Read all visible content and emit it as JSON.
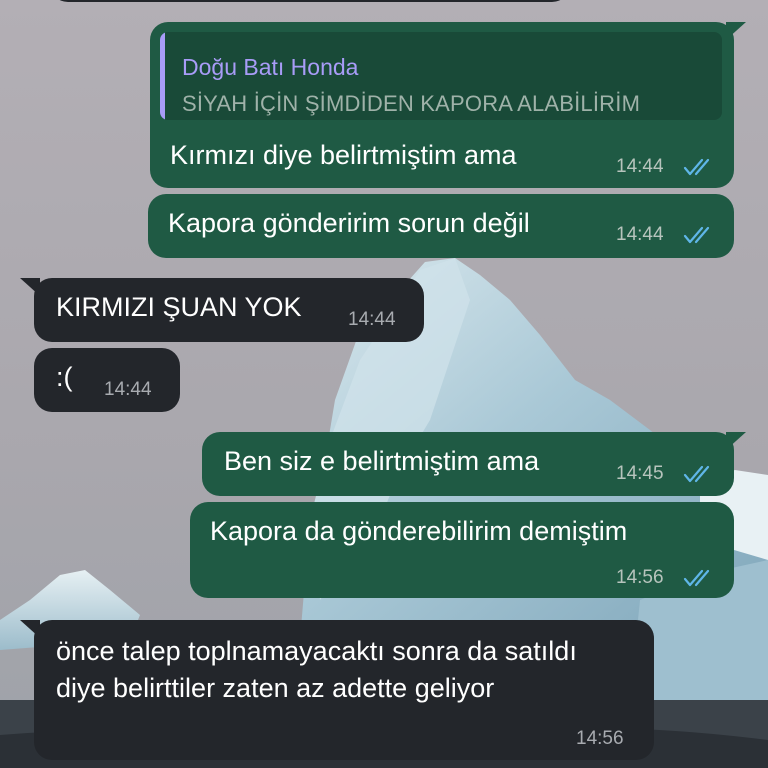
{
  "colors": {
    "outgoing_bubble": "#1f5a44",
    "incoming_bubble": "#23262b",
    "read_ticks": "#5fb6e8",
    "quote_accent": "#a89cf7"
  },
  "messages": [
    {
      "direction": "outgoing",
      "reply": {
        "author": "Doğu Batı Honda",
        "text": "SİYAH İÇİN ŞİMDİDEN KAPORA ALABİLİRİM"
      },
      "text": "Kırmızı diye belirtmiştim ama",
      "time": "14:44",
      "status_icon": "double-check-read-icon"
    },
    {
      "direction": "outgoing",
      "text": "Kapora gönderirim sorun değil",
      "time": "14:44",
      "status_icon": "double-check-read-icon"
    },
    {
      "direction": "incoming",
      "text": "KIRMIZI ŞUAN YOK",
      "time": "14:44"
    },
    {
      "direction": "incoming",
      "text": ":(",
      "time": "14:44"
    },
    {
      "direction": "outgoing",
      "text": "Ben siz e belirtmiştim ama",
      "time": "14:45",
      "status_icon": "double-check-read-icon"
    },
    {
      "direction": "outgoing",
      "text": "Kapora da gönderebilirim demiştim",
      "time": "14:56",
      "status_icon": "double-check-read-icon"
    },
    {
      "direction": "incoming",
      "text": "önce talep toplnamayacaktı sonra da satıldı diye belirttiler zaten az adette geliyor",
      "time": "14:56"
    }
  ]
}
